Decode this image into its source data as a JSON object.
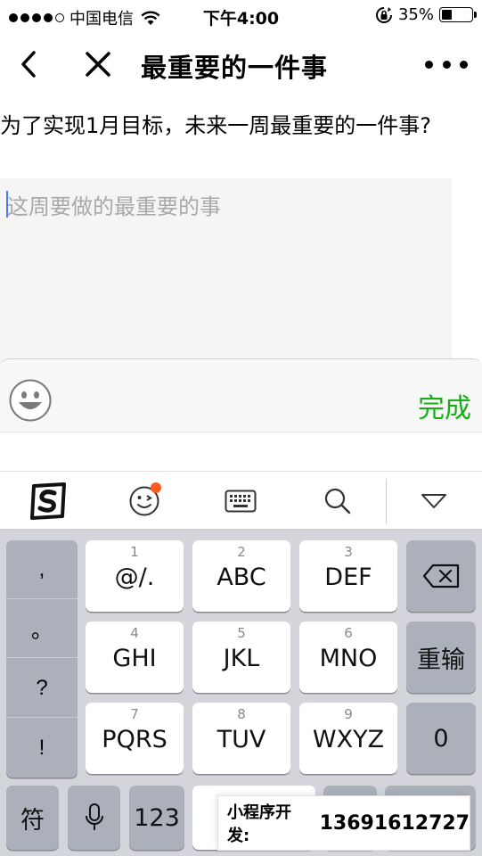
{
  "status_bar": {
    "carrier": "中国电信",
    "time": "下午4:00",
    "battery_percent": "35%",
    "battery_level": 0.35,
    "signal_bars": 4
  },
  "nav": {
    "title": "最重要的一件事"
  },
  "form": {
    "question": "为了实现1月目标，未来一周最重要的一件事?",
    "placeholder": "这周要做的最重要的事"
  },
  "accessory": {
    "done_label": "完成"
  },
  "keyboard": {
    "punct_keys": [
      ",",
      "。",
      "?",
      "!"
    ],
    "keys": [
      {
        "num": "1",
        "label": "@/."
      },
      {
        "num": "2",
        "label": "ABC"
      },
      {
        "num": "3",
        "label": "DEF"
      },
      {
        "num": "4",
        "label": "GHI"
      },
      {
        "num": "5",
        "label": "JKL"
      },
      {
        "num": "6",
        "label": "MNO"
      },
      {
        "num": "7",
        "label": "PQRS"
      },
      {
        "num": "8",
        "label": "TUV"
      },
      {
        "num": "9",
        "label": "WXYZ"
      }
    ],
    "retype_label": "重输",
    "zero_label": "0",
    "symbol_label": "符",
    "number_label": "123"
  },
  "watermark": {
    "label": "小程序开发:",
    "phone": "13691612727"
  },
  "colors": {
    "accent_green": "#1aad19",
    "badge_orange": "#ff5a1f",
    "caret_blue": "#4b7bf5"
  }
}
